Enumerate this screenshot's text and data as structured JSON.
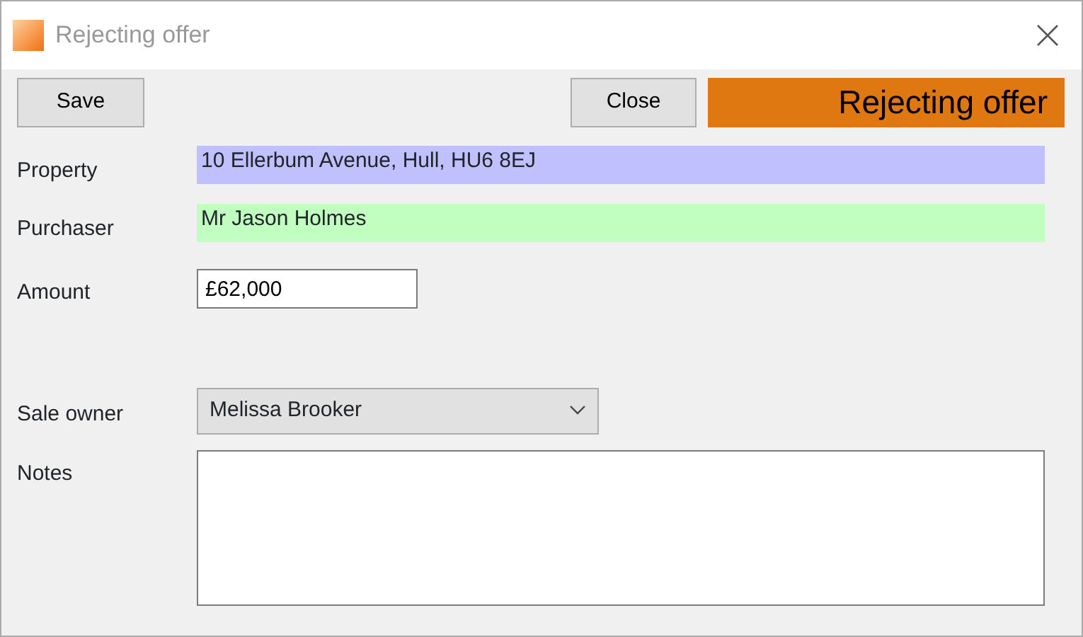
{
  "window": {
    "title": "Rejecting offer"
  },
  "toolbar": {
    "buttons": [
      "Save",
      "Close"
    ],
    "banner": "Rejecting offer"
  },
  "fields": [
    {
      "kind": "display",
      "label": "Property",
      "value": "10 Ellerbum Avenue, Hull, HU6 8EJ",
      "color": "#c0c0ff"
    },
    {
      "kind": "display",
      "label": "Purchaser",
      "value": "Mr Jason Holmes",
      "color": "#c0ffc0"
    },
    {
      "kind": "input",
      "label": "Amount",
      "value": "£62,000"
    },
    {
      "kind": "select",
      "label": "Sale owner",
      "value": "Melissa Brooker"
    },
    {
      "kind": "textarea",
      "label": "Notes"
    }
  ]
}
